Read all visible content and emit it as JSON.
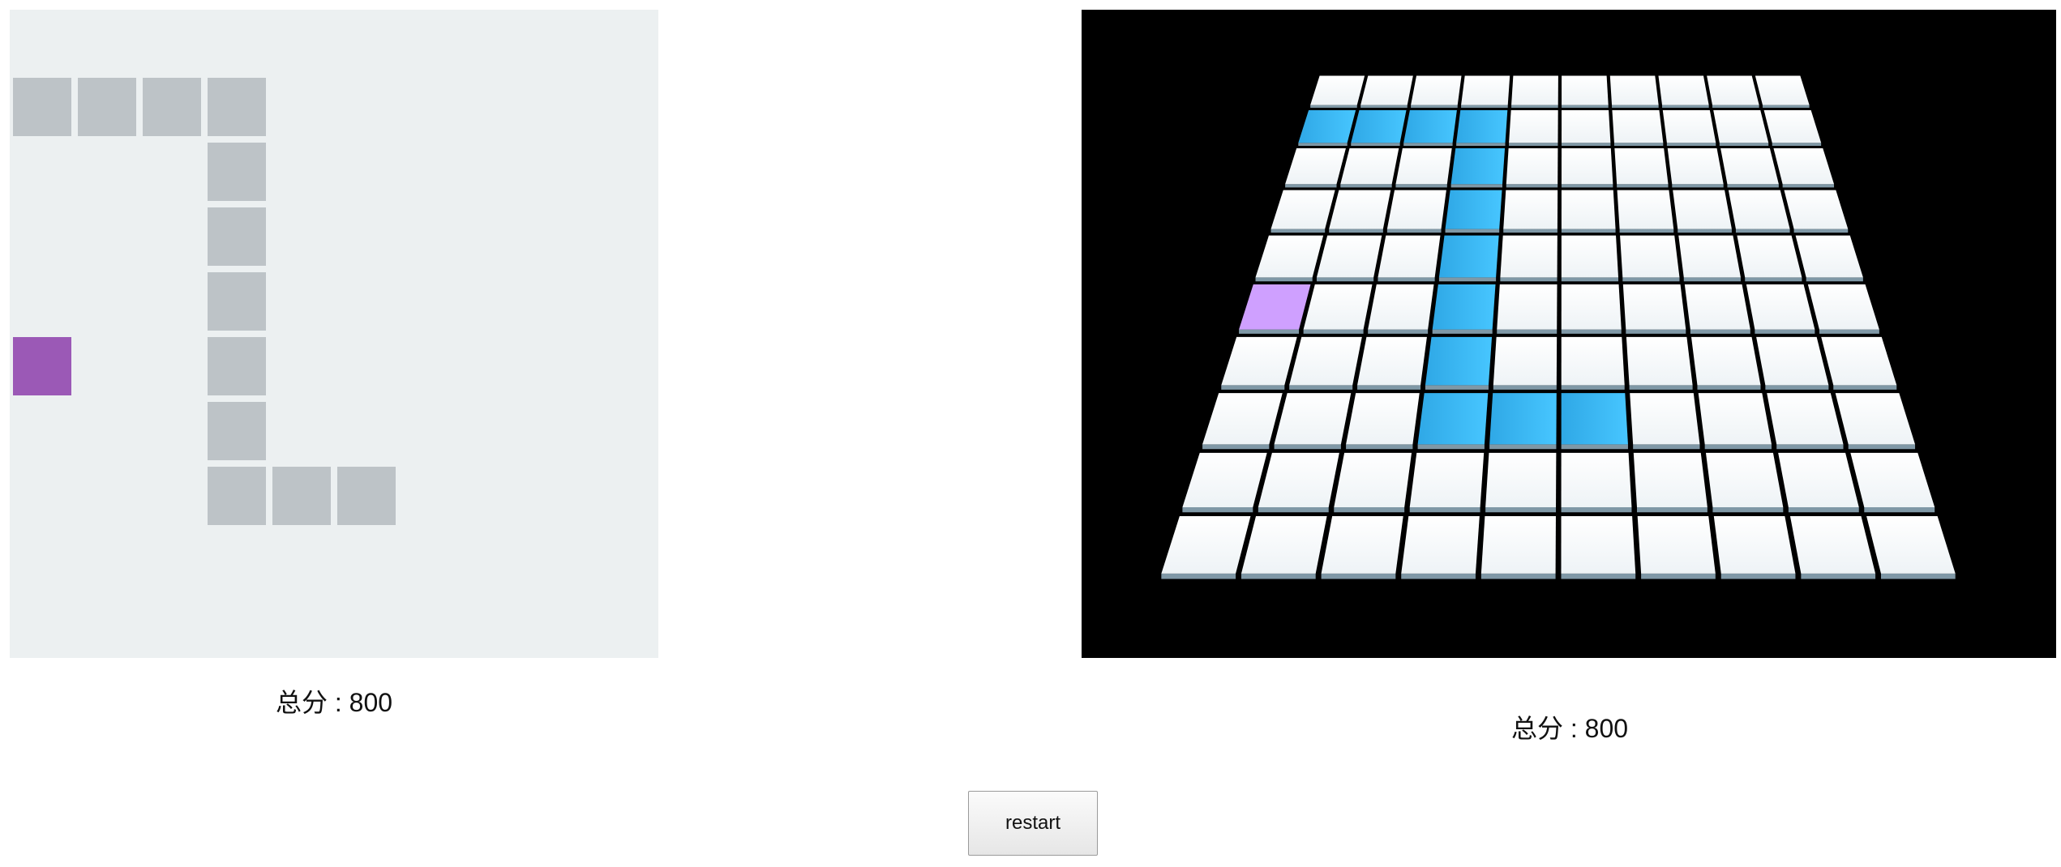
{
  "grid": {
    "cols": 10,
    "rows": 10
  },
  "colors": {
    "board_background": "#ecf0f1",
    "snake_cell_2d": "#bdc3c7",
    "food_cell_2d": "#9b59b6",
    "view3d_background": "#000000",
    "tile_top": "#ffffff",
    "tile_side": "#7f98a6",
    "snake_tile_3d_light": "#47c6ff",
    "snake_tile_3d_dark": "#2fa8e6",
    "food_tile_3d": "#cfa0ff"
  },
  "snake": [
    [
      0,
      1
    ],
    [
      1,
      1
    ],
    [
      2,
      1
    ],
    [
      3,
      1
    ],
    [
      3,
      2
    ],
    [
      3,
      3
    ],
    [
      3,
      4
    ],
    [
      3,
      5
    ],
    [
      3,
      6
    ],
    [
      3,
      7
    ],
    [
      4,
      7
    ],
    [
      5,
      7
    ]
  ],
  "food": [
    0,
    5
  ],
  "score_left": "总分 : 800",
  "score_right": "总分 : 800",
  "restart_label": "restart"
}
